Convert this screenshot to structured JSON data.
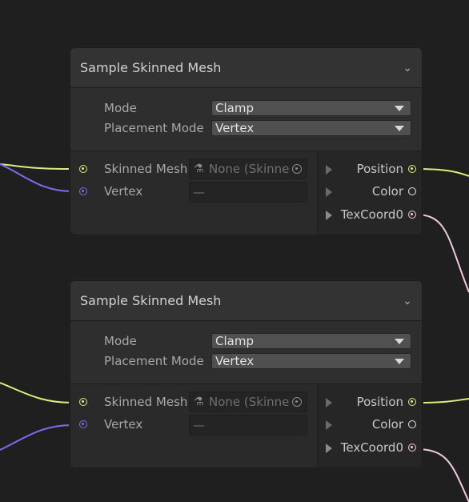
{
  "colors": {
    "position_port": "#d7f07a",
    "vertex_port": "#7b6cf0",
    "color_port": "#e6e6e6",
    "texcoord_port": "#f2c9dd"
  },
  "nodes": [
    {
      "title": "Sample Skinned Mesh",
      "collapse_icon": "chevron-down-icon",
      "settings": [
        {
          "label": "Mode",
          "value": "Clamp"
        },
        {
          "label": "Placement Mode",
          "value": "Vertex"
        }
      ],
      "inputs": [
        {
          "label": "Skinned Mesh",
          "field_value": "None (Skinne",
          "field_icon": "skinned-mesh-icon"
        },
        {
          "label": "Vertex",
          "field_value": "—"
        }
      ],
      "outputs": [
        {
          "label": "Position"
        },
        {
          "label": "Color"
        },
        {
          "label": "TexCoord0"
        }
      ]
    },
    {
      "title": "Sample Skinned Mesh",
      "collapse_icon": "chevron-down-icon",
      "settings": [
        {
          "label": "Mode",
          "value": "Clamp"
        },
        {
          "label": "Placement Mode",
          "value": "Vertex"
        }
      ],
      "inputs": [
        {
          "label": "Skinned Mesh",
          "field_value": "None (Skinne",
          "field_icon": "skinned-mesh-icon"
        },
        {
          "label": "Vertex",
          "field_value": "—"
        }
      ],
      "outputs": [
        {
          "label": "Position"
        },
        {
          "label": "Color"
        },
        {
          "label": "TexCoord0"
        }
      ]
    }
  ]
}
